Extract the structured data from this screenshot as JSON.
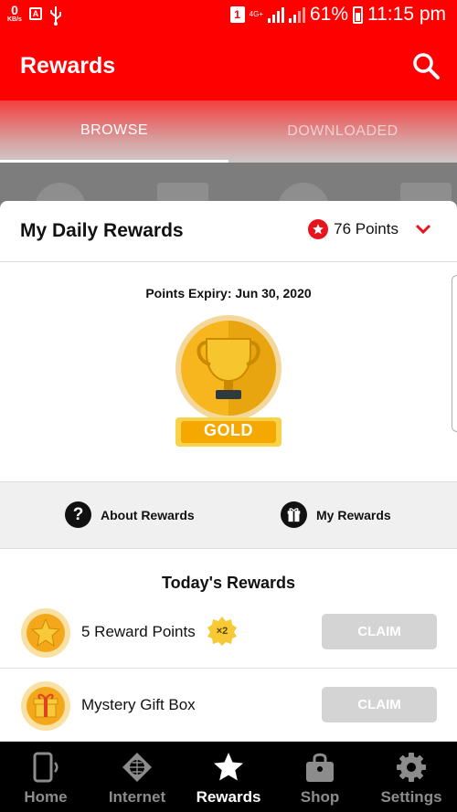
{
  "status_bar": {
    "net_speed_value": "0",
    "net_speed_unit": "KB/s",
    "sim_slot": "1",
    "network_type": "4G+",
    "battery_percent": "61%",
    "time": "11:15 pm",
    "color": "#ff0000"
  },
  "app_bar": {
    "title": "Rewards",
    "search_icon": "search-icon"
  },
  "tabs": [
    {
      "label": "BROWSE",
      "active": true
    },
    {
      "label": "DOWNLOADED",
      "active": false
    }
  ],
  "daily_rewards": {
    "title": "My Daily Rewards",
    "points_label": "76 Points",
    "expiry_text": "Points Expiry: Jun 30, 2020",
    "tier": "GOLD"
  },
  "links": {
    "about": "About Rewards",
    "mine": "My Rewards"
  },
  "today": {
    "title": "Today's Rewards",
    "items": [
      {
        "label": "5 Reward Points",
        "badge": "×2",
        "button": "CLAIM",
        "icon": "star-coin-icon"
      },
      {
        "label": "Mystery Gift Box",
        "button": "CLAIM",
        "icon": "gift-coin-icon"
      }
    ]
  },
  "bottom_nav": [
    {
      "label": "Home",
      "icon": "phone-icon",
      "active": false
    },
    {
      "label": "Internet",
      "icon": "globe-icon",
      "active": false
    },
    {
      "label": "Rewards",
      "icon": "star-icon",
      "active": true
    },
    {
      "label": "Shop",
      "icon": "shopping-bag-icon",
      "active": false
    },
    {
      "label": "Settings",
      "icon": "gear-icon",
      "active": false
    }
  ],
  "colors": {
    "brand": "#ff0000",
    "gold": "#f4b400",
    "claim_disabled": "#d4d4d4"
  }
}
